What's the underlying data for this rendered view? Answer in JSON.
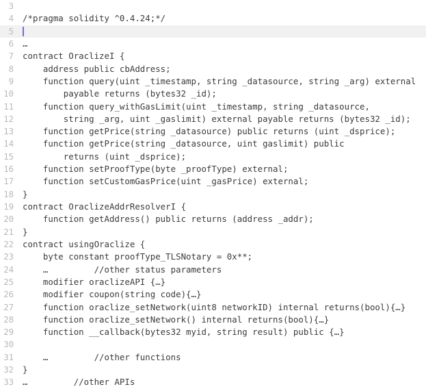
{
  "editor": {
    "language": "solidity",
    "caret_line": 5,
    "highlight_line": 5,
    "colors": {
      "background": "#ffffff",
      "text": "#3b3b3b",
      "gutter_text": "#b9b9b9",
      "active_line_background": "#f1f1f1",
      "caret": "#6b6bdf"
    },
    "first_line_number": 3,
    "last_line_number": 33,
    "lines": [
      {
        "number": "3",
        "text": ""
      },
      {
        "number": "4",
        "text": "/*pragma solidity ^0.4.24;*/"
      },
      {
        "number": "5",
        "text": ""
      },
      {
        "number": "6",
        "text": "…"
      },
      {
        "number": "7",
        "text": "contract OraclizeI {"
      },
      {
        "number": "8",
        "text": "    address public cbAddress;"
      },
      {
        "number": "9",
        "text": "    function query(uint _timestamp, string _datasource, string _arg) external"
      },
      {
        "number": "10",
        "text": "        payable returns (bytes32 _id);"
      },
      {
        "number": "11",
        "text": "    function query_withGasLimit(uint _timestamp, string _datasource,"
      },
      {
        "number": "12",
        "text": "        string _arg, uint _gaslimit) external payable returns (bytes32 _id);"
      },
      {
        "number": "13",
        "text": "    function getPrice(string _datasource) public returns (uint _dsprice);"
      },
      {
        "number": "14",
        "text": "    function getPrice(string _datasource, uint gaslimit) public"
      },
      {
        "number": "15",
        "text": "        returns (uint _dsprice);"
      },
      {
        "number": "16",
        "text": "    function setProofType(byte _proofType) external;"
      },
      {
        "number": "17",
        "text": "    function setCustomGasPrice(uint _gasPrice) external;"
      },
      {
        "number": "18",
        "text": "}"
      },
      {
        "number": "19",
        "text": "contract OraclizeAddrResolverI {"
      },
      {
        "number": "20",
        "text": "    function getAddress() public returns (address _addr);"
      },
      {
        "number": "21",
        "text": "}"
      },
      {
        "number": "22",
        "text": "contract usingOraclize {"
      },
      {
        "number": "23",
        "text": "    byte constant proofType_TLSNotary = 0x**;"
      },
      {
        "number": "24",
        "text": "    …         //other status parameters"
      },
      {
        "number": "25",
        "text": "    modifier oraclizeAPI {…}"
      },
      {
        "number": "26",
        "text": "    modifier coupon(string code){…}"
      },
      {
        "number": "27",
        "text": "    function oraclize_setNetwork(uint8 networkID) internal returns(bool){…}"
      },
      {
        "number": "28",
        "text": "    function oraclize_setNetwork() internal returns(bool){…}"
      },
      {
        "number": "29",
        "text": "    function __callback(bytes32 myid, string result) public {…}"
      },
      {
        "number": "30",
        "text": ""
      },
      {
        "number": "31",
        "text": "    …         //other functions"
      },
      {
        "number": "32",
        "text": "}"
      },
      {
        "number": "33",
        "text": "…         //other APIs"
      }
    ]
  }
}
